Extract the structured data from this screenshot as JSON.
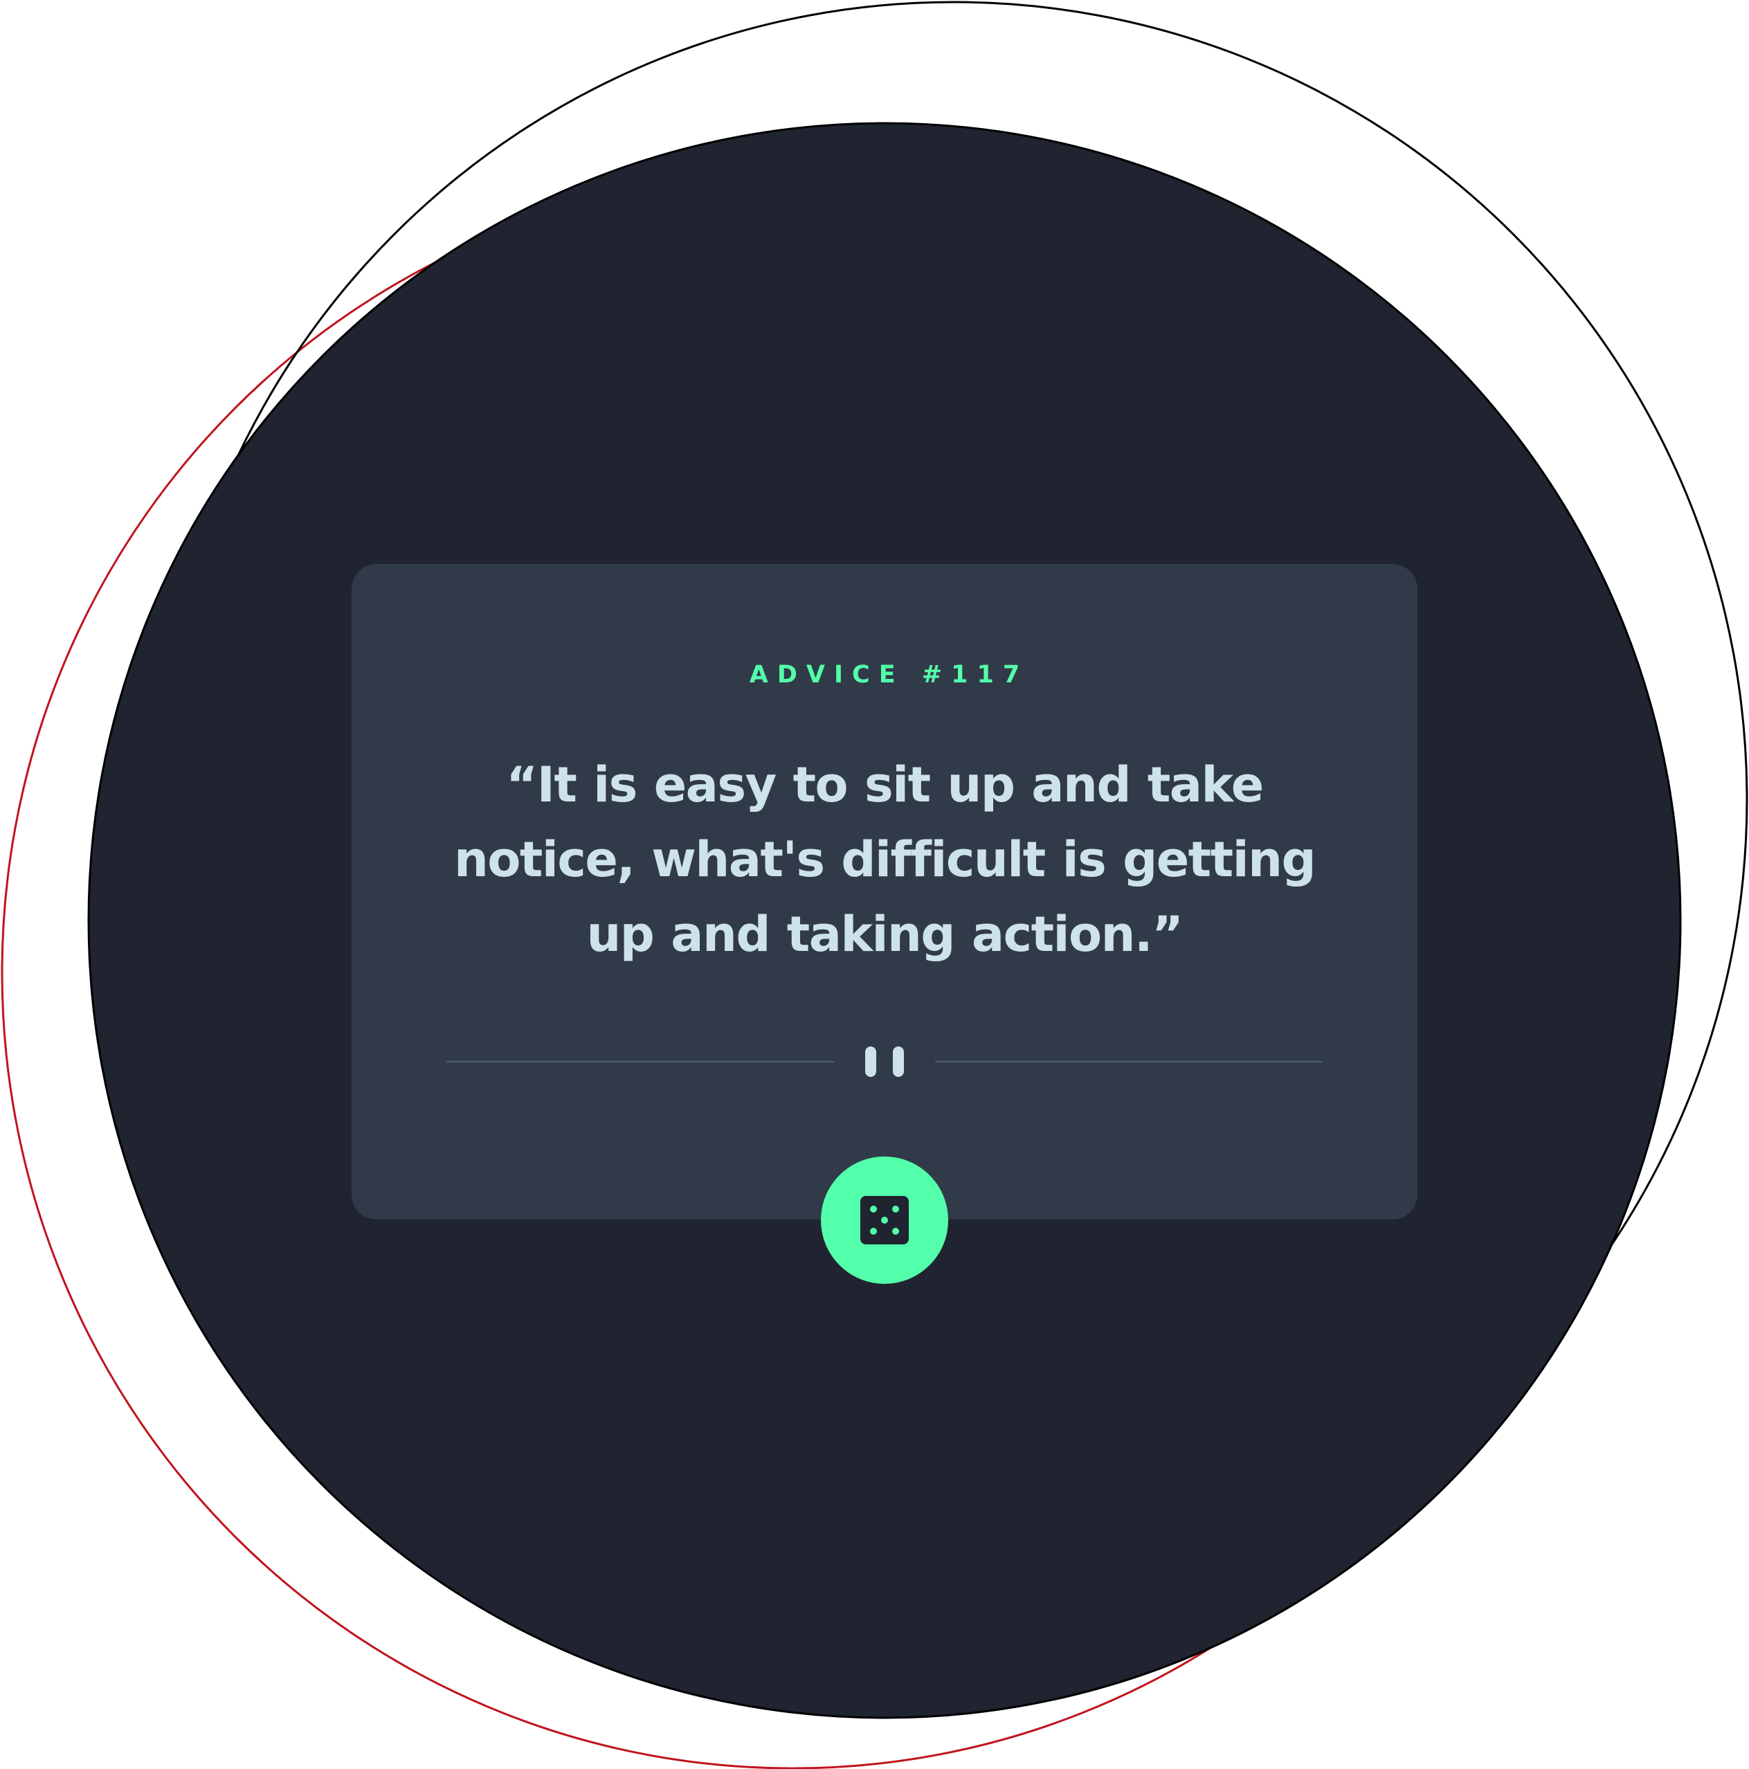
{
  "advice": {
    "label": "ADVICE #117",
    "quote": "“It is easy to sit up and take notice, what's difficult is getting up and taking action.”"
  },
  "controls": {
    "divider_icon": "pause-icon",
    "dice_icon": "dice-icon"
  },
  "colors": {
    "background_dark": "#1f2430",
    "card": "#313a48",
    "accent": "#53ffaa",
    "text": "#cee3e9",
    "divider": "#4f5d74",
    "outline_black": "#000000",
    "outline_red": "#c0141e"
  }
}
